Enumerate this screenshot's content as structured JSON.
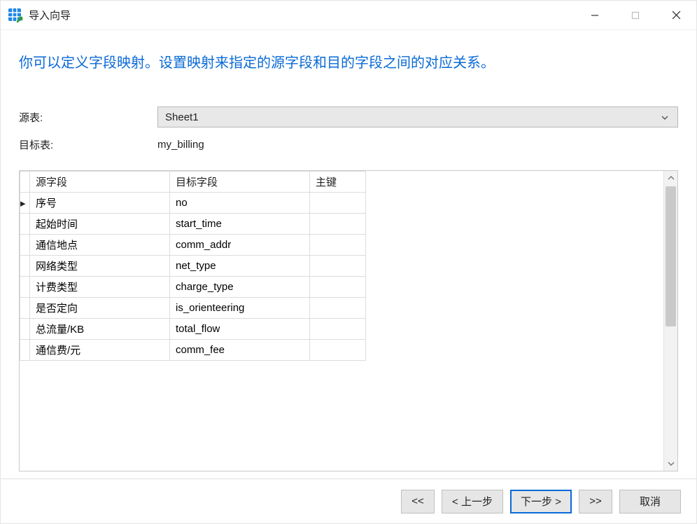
{
  "titlebar": {
    "title": "导入向导"
  },
  "instruction": "你可以定义字段映射。设置映射来指定的源字段和目的字段之间的对应关系。",
  "form": {
    "source_table_label": "源表:",
    "source_table_value": "Sheet1",
    "target_table_label": "目标表:",
    "target_table_value": "my_billing"
  },
  "table": {
    "headers": {
      "source": "源字段",
      "target": "目标字段",
      "pk": "主键"
    },
    "rows": [
      {
        "marker": "▸",
        "source": "序号",
        "target": "no",
        "pk": ""
      },
      {
        "marker": "",
        "source": "起始时间",
        "target": "start_time",
        "pk": ""
      },
      {
        "marker": "",
        "source": "通信地点",
        "target": "comm_addr",
        "pk": ""
      },
      {
        "marker": "",
        "source": "网络类型",
        "target": "net_type",
        "pk": ""
      },
      {
        "marker": "",
        "source": "计费类型",
        "target": "charge_type",
        "pk": ""
      },
      {
        "marker": "",
        "source": "是否定向",
        "target": "is_orienteering",
        "pk": ""
      },
      {
        "marker": "",
        "source": "总流量/KB",
        "target": "total_flow",
        "pk": ""
      },
      {
        "marker": "",
        "source": "通信费/元",
        "target": "comm_fee",
        "pk": ""
      }
    ]
  },
  "footer": {
    "first": "<<",
    "prev": "< 上一步",
    "next": "下一步 >",
    "last": ">>",
    "cancel": "取消"
  }
}
